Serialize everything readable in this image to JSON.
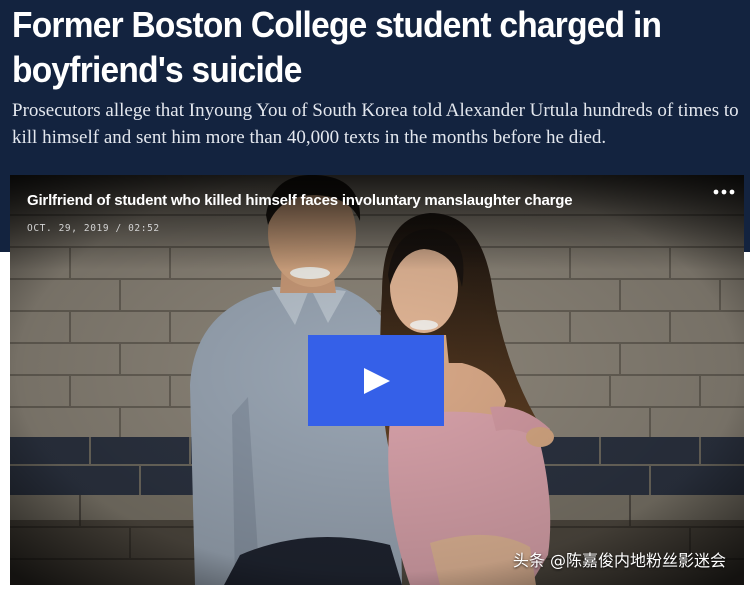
{
  "article": {
    "headline": "Former Boston College student charged in boyfriend's suicide",
    "dek": "Prosecutors allege that Inyoung You of South Korea told Alexander Urtula hundreds of times to kill himself and sent him more than 40,000 texts in the months before he died."
  },
  "video": {
    "title": "Girlfriend of student who killed himself faces involuntary manslaughter charge",
    "date": "OCT. 29, 2019",
    "duration": "02:52",
    "meta": "OCT. 29, 2019 / 02:52",
    "more_icon": "more-options-icon",
    "play_icon": "play-icon"
  },
  "watermark": {
    "text": "头条 @陈嘉俊内地粉丝影迷会"
  },
  "colors": {
    "hero_background": "#13233f",
    "play_button": "#3560e8",
    "headline": "#ffffff"
  }
}
